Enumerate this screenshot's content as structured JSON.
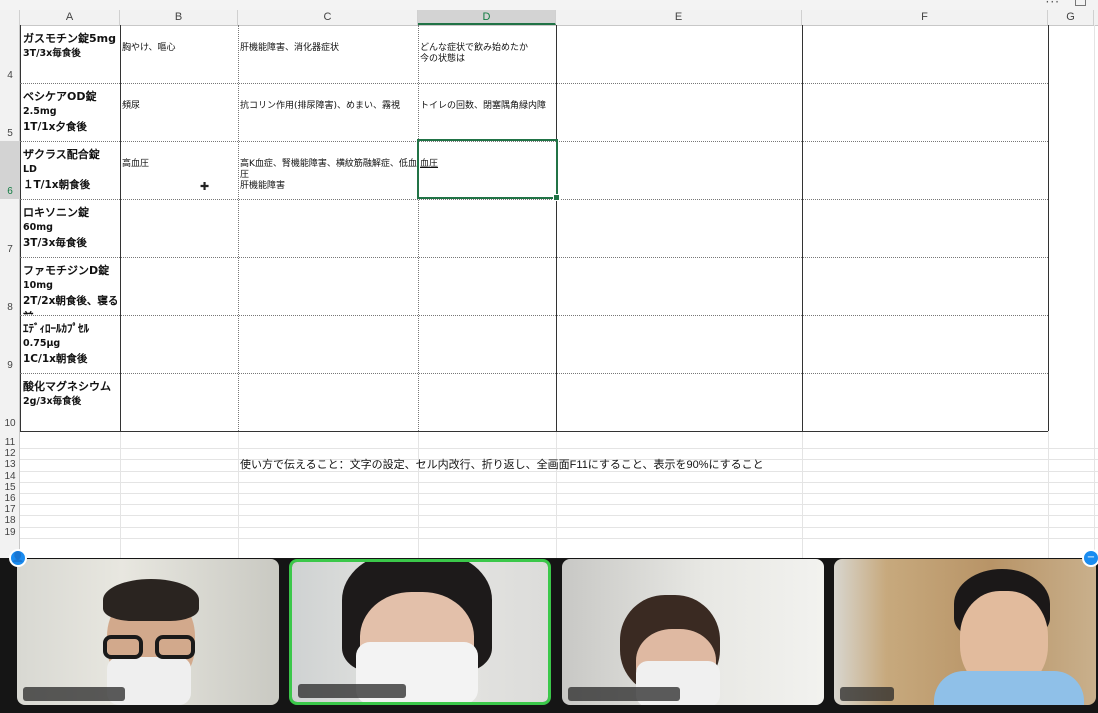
{
  "spreadsheet": {
    "columns": [
      "A",
      "B",
      "C",
      "D",
      "E",
      "F",
      "G"
    ],
    "selected_column": "D",
    "selected_row": "6",
    "rows": [
      {
        "num": "4",
        "a": {
          "name": "ガスモチン錠5mg",
          "l2": "3T/3x毎食後",
          "l3": ""
        },
        "b": "胸やけ、嘔心",
        "c": "肝機能障害、消化器症状",
        "d": "どんな症状で飲み始めたか\n今の状態は"
      },
      {
        "num": "5",
        "a": {
          "name": "ベシケアOD錠",
          "l2": "2.5mg",
          "l3": "1T/1x夕食後"
        },
        "b": "頻尿",
        "c": "抗コリン作用(排尿障害)、めまい、霧視",
        "d": "トイレの回数、閉塞隅角緑内障"
      },
      {
        "num": "6",
        "a": {
          "name": "ザクラス配合錠",
          "l2": "LD",
          "l3": "１T/1x朝食後"
        },
        "b": "高血圧",
        "c": "高K血症、腎機能障害、横紋筋融解症、低血圧\n肝機能障害",
        "d": "血圧"
      },
      {
        "num": "7",
        "a": {
          "name": "ロキソニン錠",
          "l2": "60mg",
          "l3": "3T/3x毎食後"
        },
        "b": "",
        "c": "",
        "d": ""
      },
      {
        "num": "8",
        "a": {
          "name": "ファモチジンD錠",
          "l2": "10mg",
          "l3": "2T/2x朝食後、寝る前"
        },
        "b": "",
        "c": "",
        "d": ""
      },
      {
        "num": "9",
        "a": {
          "name": "ｴﾃﾞｨﾛｰﾙｶﾌﾟｾﾙ",
          "l2": "0.75μg",
          "l3": "1C/1x朝食後"
        },
        "b": "",
        "c": "",
        "d": ""
      },
      {
        "num": "10",
        "a": {
          "name": "酸化マグネシウム",
          "l2": "2g/3x毎食後",
          "l3": ""
        },
        "b": "",
        "c": "",
        "d": ""
      }
    ],
    "small_rows": [
      "11",
      "12",
      "13",
      "14",
      "15",
      "16",
      "17",
      "18",
      "19"
    ],
    "note": "使い方で伝えること：文字の設定、セル内改行、折り返し、全画面F11にすること、表示を90%にすること"
  },
  "window": {
    "more_icon": "ellipsis-icon",
    "fullscreen_icon": "fullscreen-icon"
  },
  "meeting": {
    "participants": [
      {
        "id": "p1",
        "active": false
      },
      {
        "id": "p2",
        "active": true
      },
      {
        "id": "p3",
        "active": false
      },
      {
        "id": "p4",
        "active": false
      }
    ],
    "accent": "#3bc84a",
    "badge_color": "#1a8cf0"
  }
}
